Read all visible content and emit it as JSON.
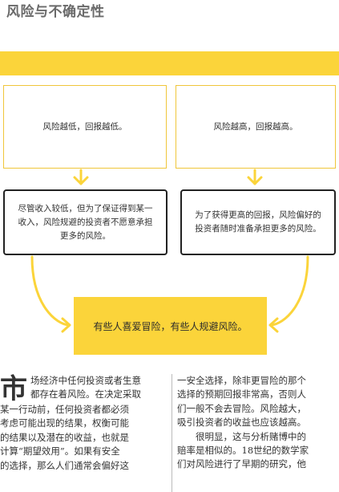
{
  "page": {
    "title": "风险与不确定性"
  },
  "diagram": {
    "top_left": "风险越低，回报越低。",
    "top_right": "风险越高，回报越高。",
    "bottom_left": "尽管收入较低，但为了保证得到某一收入，风险规避的投资者不愿意承担更多的风险。",
    "bottom_right": "为了获得更高的回报，风险偏好的投资者随时准备承担更多的风险。",
    "conclusion": "有些人喜爱冒险，有些人规避风险。"
  },
  "body": {
    "left_dropcap": "市",
    "left_lines": [
      "场经济中任何投资或者生意",
      "都存在着风险。在决定采取",
      "某一行动前，任何投资者都必须",
      "考虑可能出现的结果，权衡可能",
      "的结果以及潜在的收益，也就是",
      "计算“期望效用”。如果有安全",
      "的选择，那么人们通常会偏好这"
    ],
    "right_lines": [
      "一安全选择，除非更冒险的那个",
      "选择的预期回报非常高，否则人",
      "们一般不会去冒险。风险越大，",
      "吸引投资者的收益也应该越高。",
      "很明显，这与分析赌博中的",
      "赔率是相似的。18世纪的数学家",
      "们对风险进行了早期的研究，他"
    ]
  },
  "colors": {
    "accent_yellow": "#fbd43a",
    "title_gray": "#6a6a6a",
    "box_border_dark": "#222222"
  }
}
